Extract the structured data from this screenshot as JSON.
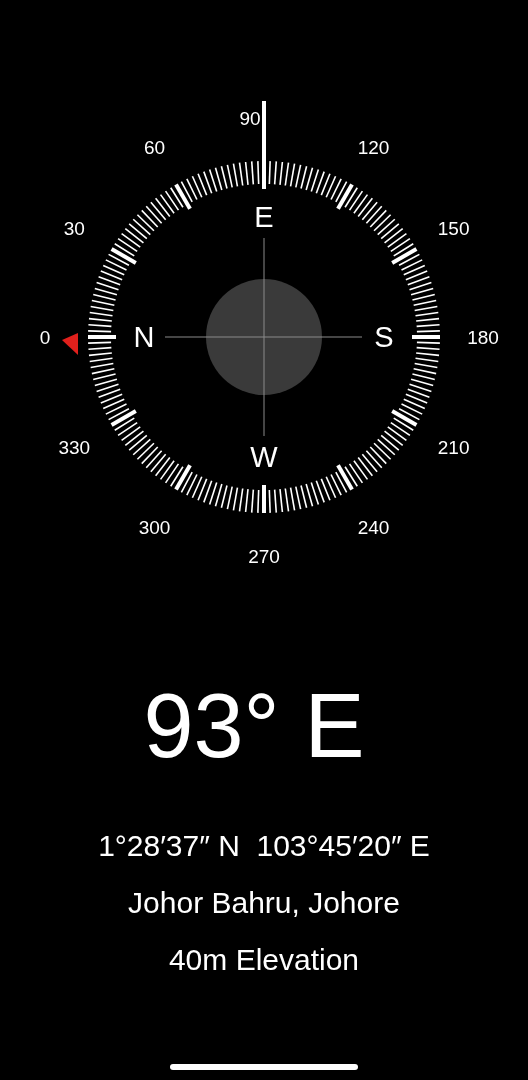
{
  "compass": {
    "degree_labels": [
      "0",
      "30",
      "60",
      "90",
      "120",
      "150",
      "180",
      "210",
      "240",
      "270",
      "300",
      "330"
    ],
    "cardinals": [
      "N",
      "E",
      "S",
      "W"
    ]
  },
  "heading": "93° E",
  "coordinates": "1°28′37″ N  103°45′20″ E",
  "location": "Johor Bahru, Johore",
  "elevation": "40m Elevation"
}
